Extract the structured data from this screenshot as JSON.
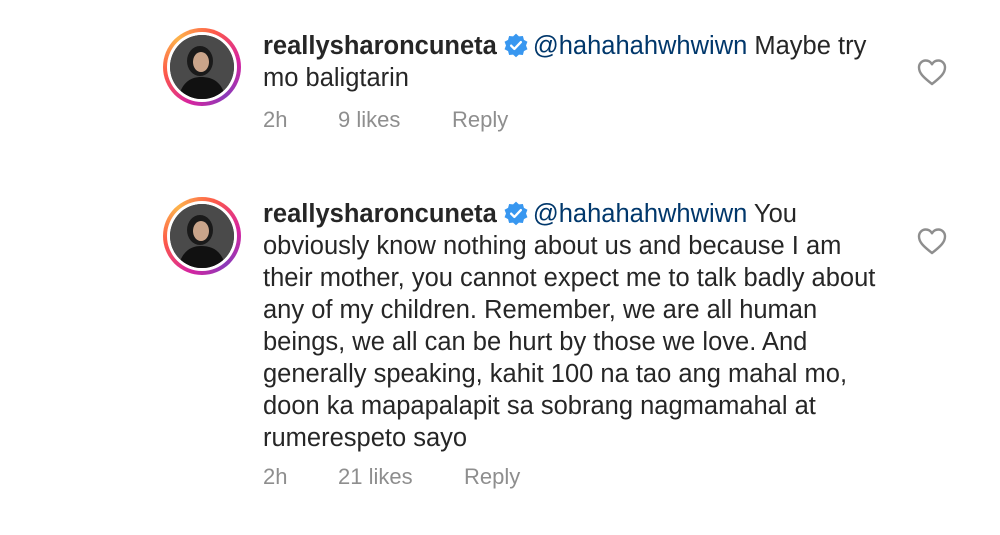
{
  "comments": [
    {
      "username": "reallysharoncuneta",
      "mention": "@hahahahwhwiwn",
      "text": " Maybe try mo baligtarin",
      "time": "2h",
      "likes": "9 likes",
      "reply": "Reply"
    },
    {
      "username": "reallysharoncuneta",
      "mention": "@hahahahwhwiwn",
      "text": " You obviously know nothing about us and because I am their mother, you cannot expect me to talk badly about any of my children. Remember, we are all human beings, we all can be hurt by those we love. And generally speaking, kahit 100 na tao ang mahal mo, doon ka mapapalapit sa sobrang nagmamahal at rumerespeto sayo",
      "time": "2h",
      "likes": "21 likes",
      "reply": "Reply"
    }
  ],
  "icons": {
    "verified": "verified-badge-icon",
    "like": "heart-icon"
  },
  "colors": {
    "verified": "#3897f0",
    "mention": "#00376b",
    "meta": "#8e8e8e",
    "text": "#262626"
  }
}
